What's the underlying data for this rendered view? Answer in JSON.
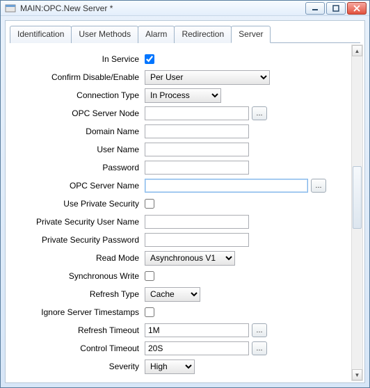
{
  "window": {
    "title": "MAIN:OPC.New Server *"
  },
  "tabs": [
    {
      "label": "Identification"
    },
    {
      "label": "User Methods"
    },
    {
      "label": "Alarm"
    },
    {
      "label": "Redirection"
    },
    {
      "label": "Server",
      "active": true
    }
  ],
  "browse": "...",
  "fields": {
    "in_service": {
      "label": "In Service",
      "checked": true
    },
    "confirm": {
      "label": "Confirm Disable/Enable",
      "value": "Per User"
    },
    "conn_type": {
      "label": "Connection Type",
      "value": "In Process"
    },
    "opc_node": {
      "label": "OPC Server Node",
      "value": ""
    },
    "domain": {
      "label": "Domain Name",
      "value": ""
    },
    "user": {
      "label": "User Name",
      "value": ""
    },
    "pass": {
      "label": "Password",
      "value": ""
    },
    "opc_name": {
      "label": "OPC Server Name",
      "value": ""
    },
    "priv_sec": {
      "label": "Use Private Security",
      "checked": false
    },
    "priv_user": {
      "label": "Private Security User Name",
      "value": ""
    },
    "priv_pass": {
      "label": "Private Security Password",
      "value": ""
    },
    "read_mode": {
      "label": "Read Mode",
      "value": "Asynchronous V1"
    },
    "sync_write": {
      "label": "Synchronous Write",
      "checked": false
    },
    "refresh_type": {
      "label": "Refresh Type",
      "value": "Cache"
    },
    "ignore_ts": {
      "label": "Ignore Server Timestamps",
      "checked": false
    },
    "refresh_timeout": {
      "label": "Refresh Timeout",
      "value": "1M"
    },
    "control_timeout": {
      "label": "Control Timeout",
      "value": "20S"
    },
    "severity": {
      "label": "Severity",
      "value": "High"
    }
  }
}
